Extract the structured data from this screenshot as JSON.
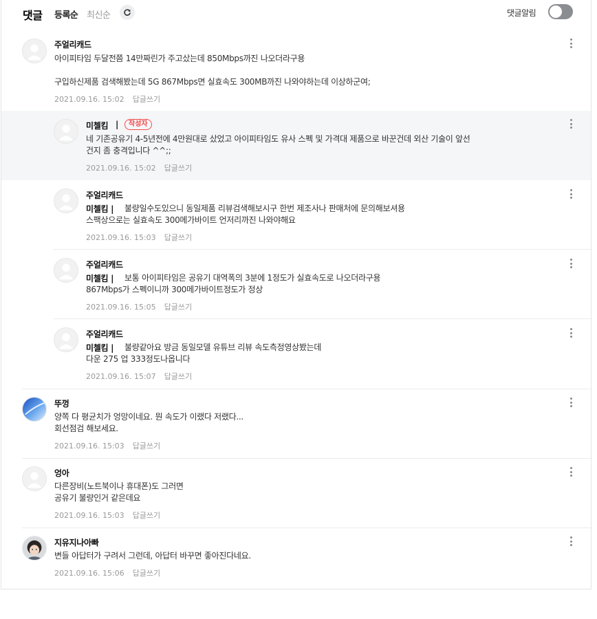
{
  "header": {
    "title": "댓글",
    "sort_by_registration": "등록순",
    "sort_by_latest": "최신순",
    "refresh_icon": "refresh-icon",
    "notify_label": "댓글알림",
    "notify_on": false
  },
  "comments": [
    {
      "nick": "주얼리캐드",
      "text": "아이피타임 두달전쯤 14만짜린가 주고샀는데 850Mbps까진 나오더라구용\n\n구입하신제품 검색해봤는데 5G 867Mbps면 실효속도 300MB까진 나와야하는데 이상하군여;",
      "date": "2021.09.16. 15:02",
      "reply": "답글쓰기"
    },
    {
      "nick": "미첼킴",
      "separator": "|",
      "badge": "작성자",
      "text": "네 기존공유기 4-5년전에 4만원대로 샀었고 아이피타임도 유사 스펙 및 가격대 제품으로 바꾼건데 외산 기술이 앞선\n건지 좀 충격입니다 ^^;;",
      "date": "2021.09.16. 15:02",
      "reply": "답글쓰기"
    },
    {
      "nick": "주얼리캐드",
      "mention": "미첼킴 |",
      "text": "불량일수도있으니 동일제품 리뷰검색해보시구 한번 제조사나 판매처에 문의해보셔용\n스팩상으로는 실효속도 300메가바이트 언저리까진 나와야해요",
      "date": "2021.09.16. 15:03",
      "reply": "답글쓰기"
    },
    {
      "nick": "주얼리캐드",
      "mention": "미첼킴 |",
      "text": "보통 아이피타임은 공유기 대역폭의 3분에 1정도가 실효속도로 나오더라구용\n867Mbps가 스펙이니까 300메가바이트정도가 정상",
      "date": "2021.09.16. 15:05",
      "reply": "답글쓰기"
    },
    {
      "nick": "주얼리캐드",
      "mention": "미첼킴 |",
      "text": "불량같아요 방금 동일모델 유튜브 리뷰 속도측정영상봤는데\n다운 275 업 333정도나옵니다",
      "date": "2021.09.16. 15:07",
      "reply": "답글쓰기"
    },
    {
      "nick": "뚜껑",
      "text": "양쪽 다 평균치가 엉망이네요. 뭔 속도가 이랬다 저랬다...\n회선점검 해보세요.",
      "date": "2021.09.16. 15:03",
      "reply": "답글쓰기"
    },
    {
      "nick": "엉아",
      "text": "다른장비(노트북이나 휴대폰)도 그러면\n공유기 불량인거 같은데요",
      "date": "2021.09.16. 15:03",
      "reply": "답글쓰기"
    },
    {
      "nick": "지유지나아빠",
      "text": "변들 아답터가 구려서 그런데, 아답터 바꾸면 좋아진다네요.",
      "date": "2021.09.16. 15:06",
      "reply": "답글쓰기"
    }
  ]
}
